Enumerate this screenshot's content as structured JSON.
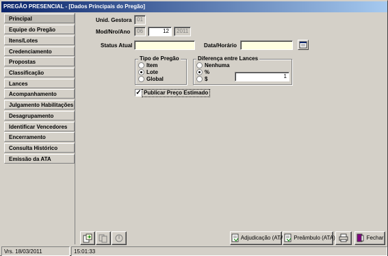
{
  "window": {
    "title": "PREGÃO PRESENCIAL - [Dados Principais do Pregão]"
  },
  "sidebar": {
    "items": [
      {
        "label": "Principal",
        "active": true
      },
      {
        "label": "Equipe do Pregão"
      },
      {
        "label": "Itens/Lotes"
      },
      {
        "label": "Credenciamento"
      },
      {
        "label": "Propostas"
      },
      {
        "label": "Classificação"
      },
      {
        "label": "Lances"
      },
      {
        "label": "Acompanhamento"
      },
      {
        "label": "Julgamento Habilitações"
      },
      {
        "label": "Desagrupamento"
      },
      {
        "label": "Identificar Vencedores"
      },
      {
        "label": "Encerramento"
      },
      {
        "label": "Consulta Histórico"
      },
      {
        "label": "Emissão da ATA"
      }
    ]
  },
  "form": {
    "unid_gestora_label": "Unid. Gestora",
    "unid_gestora_value": "01",
    "mod_nro_ano_label": "Mod/Nro/Ano",
    "mod_value": "06",
    "nro_value": "12",
    "ano_value": "2011",
    "status_label": "Status Atual",
    "status_value": "",
    "data_horario_label": "Data/Horário",
    "data_horario_value": ""
  },
  "tipo_pregao": {
    "legend": "Tipo de Pregão",
    "options": [
      "Item",
      "Lote",
      "Global"
    ],
    "selected": "Lote"
  },
  "diferenca": {
    "legend": "Diferença entre Lances",
    "options": [
      "Nenhuma",
      "%",
      "$"
    ],
    "selected": "%",
    "value": "1"
  },
  "publicar": {
    "label": "Publicar Preço Estimado",
    "checked": true,
    "check_glyph": "✓"
  },
  "toolbar": {
    "adjudicacao_label": "Adjudicação (ATA)",
    "preambulo_label": "Preâmbulo (ATA)",
    "fechar_label": "Fechar"
  },
  "status": {
    "version": "Vrs. 18/03/2011",
    "time": "15:01:33"
  },
  "icons": {
    "close": "✕"
  }
}
